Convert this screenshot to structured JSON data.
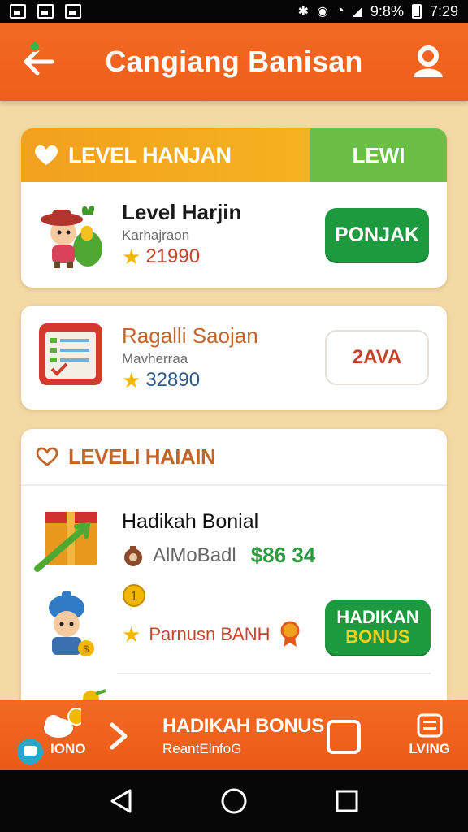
{
  "status_bar": {
    "battery_text": "9:8%",
    "time": "7:29"
  },
  "app_bar": {
    "title": "Cangiang Banisan"
  },
  "card1": {
    "header_left": "LEVEL HANJAN",
    "header_right": "LEWI",
    "item": {
      "name": "Level Harjin",
      "sub": "Karhajraon",
      "points": "21990",
      "button": "PONJAK"
    }
  },
  "card2": {
    "item": {
      "name": "Ragalli Saojan",
      "sub": "Mavherraa",
      "points": "32890",
      "button": "2AVA"
    }
  },
  "card3": {
    "header": "LEVELI HAIAIN",
    "item1": {
      "name": "Hadikah Bonial",
      "sub": "AlMoBadl",
      "amount": "$86 34"
    },
    "item2": {
      "label": "Parnusn BANH",
      "button_line1": "HADIKAN",
      "button_line2": "BONUS"
    }
  },
  "bottom_bar": {
    "left_label": "IONO",
    "title": "HADIKAH BONUS",
    "subtitle": "ReantElnfoG",
    "right_label": "LVING"
  },
  "colors": {
    "primary_orange": "#f26a22",
    "green": "#1e9a3e",
    "header_yellow": "#f2a11e",
    "header_green": "#6cbf46",
    "background": "#f3d9a4"
  }
}
